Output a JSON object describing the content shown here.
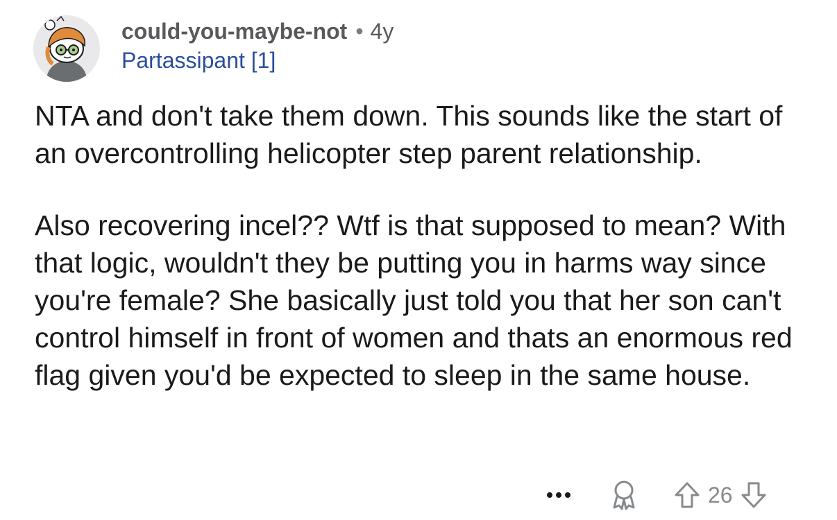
{
  "comment": {
    "username": "could-you-maybe-not",
    "separator": "•",
    "age": "4y",
    "flair": "Partassipant [1]",
    "paragraphs": [
      "NTA and don't take them down. This sounds like the start of an overcontrolling helicopter step parent relationship.",
      "Also recovering incel?? Wtf is that supposed to mean? With that logic, wouldn't they be putting you in harms way since you're female? She basically just told you that her son can't control himself in front of women and thats an enormous red flag given you'd be expected to sleep in the same house."
    ]
  },
  "actions": {
    "more_icon": "more-options-icon",
    "award_icon": "award-icon",
    "upvote_icon": "upvote-arrow-icon",
    "downvote_icon": "downvote-arrow-icon",
    "score": "26"
  },
  "colors": {
    "username": "#57595c",
    "flair": "#2a4e9c",
    "body_text": "#1a1a1b",
    "icon_gray": "#878a8c",
    "avatar_bg": "#e9e9eb",
    "avatar_hair": "#e08a3c"
  }
}
